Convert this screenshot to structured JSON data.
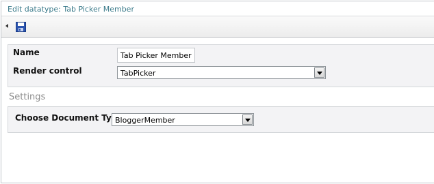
{
  "header": {
    "title": "Edit datatype: Tab Picker Member"
  },
  "toolbar": {
    "collapse_icon": "left-arrow-icon",
    "save_icon": "floppy-disk-icon"
  },
  "form": {
    "name_label": "Name",
    "name_value": "Tab Picker Member",
    "render_control_label": "Render control",
    "render_control_value": "TabPicker"
  },
  "settings": {
    "heading": "Settings",
    "doc_type_label": "Choose Document Type:",
    "doc_type_value": "BloggerMember"
  }
}
